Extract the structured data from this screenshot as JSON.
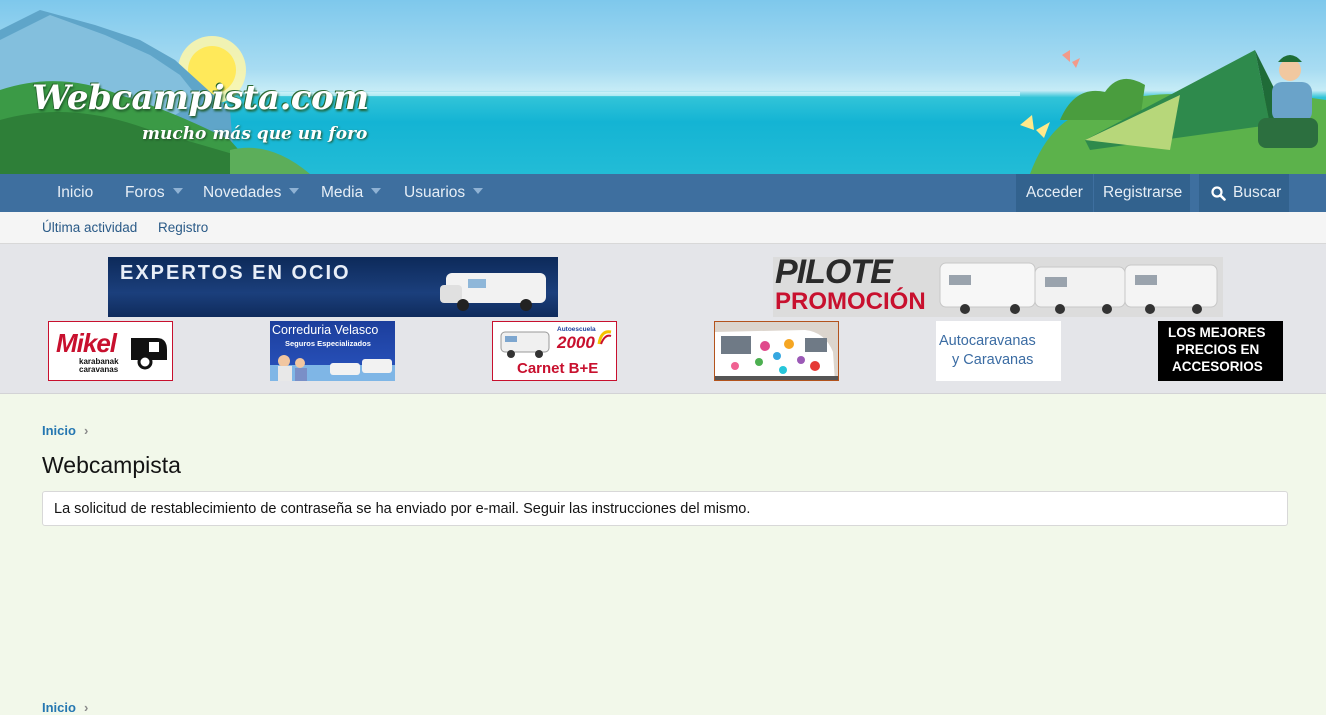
{
  "banner": {
    "site_title": "Webcampista.com",
    "tagline": "mucho más que un foro"
  },
  "nav": {
    "items": [
      {
        "label": "Inicio",
        "has_menu": false
      },
      {
        "label": "Foros",
        "has_menu": true
      },
      {
        "label": "Novedades",
        "has_menu": true
      },
      {
        "label": "Media",
        "has_menu": true
      },
      {
        "label": "Usuarios",
        "has_menu": true
      }
    ],
    "login_label": "Acceder",
    "register_label": "Registrarse",
    "search_label": "Buscar"
  },
  "subnav": {
    "items": [
      {
        "label": "Última actividad"
      },
      {
        "label": "Registro"
      }
    ]
  },
  "ads": {
    "expertos": "EXPERTOS EN OCIO",
    "pilote_brand": "PILOTE",
    "pilote_promo": "PROMOCIÓN",
    "mikel_brand": "Mikel",
    "mikel_sub1": "karabanak",
    "mikel_sub2": "caravanas",
    "velasco_title": "Correduria Velasco",
    "velasco_sub": "Seguros Especializados",
    "autoescuela_small": "Autoescuela",
    "autoescuela_num": "2000",
    "autoescuela_label": "Carnet B+E",
    "autocaravanas_line1": "Autocaravanas",
    "autocaravanas_line2": "y Caravanas",
    "mejores_line1": "LOS MEJORES",
    "mejores_line2": "PRECIOS EN",
    "mejores_line3": "ACCESORIOS"
  },
  "breadcrumb": {
    "top": "Inicio",
    "bottom": "Inicio"
  },
  "page": {
    "title": "Webcampista",
    "notice": "La solicitud de restablecimiento de contraseña se ha enviado por e-mail. Seguir las instrucciones del mismo."
  },
  "colors": {
    "nav_bg": "#3e6f9f",
    "link": "#2577b1",
    "page_bg": "#f2f8ea"
  }
}
